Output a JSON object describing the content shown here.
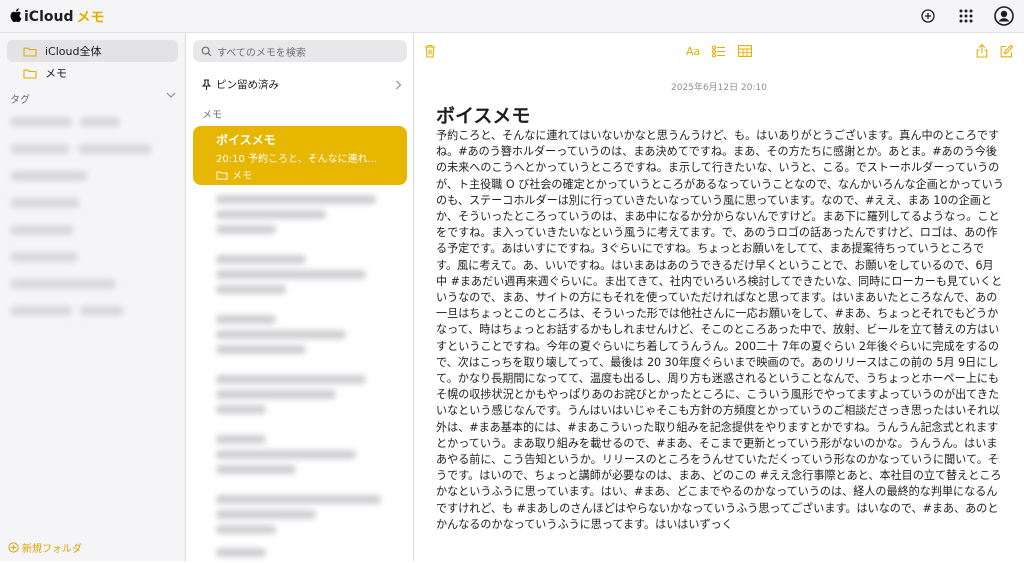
{
  "app": {
    "brand": "iCloud",
    "app_name": "メモ",
    "accent": "#e7b600"
  },
  "topbar": {
    "icons": [
      "add-circle-icon",
      "app-grid-icon",
      "account-icon"
    ]
  },
  "sidebar": {
    "folders": [
      {
        "label": "iCloud全体",
        "selected": true
      },
      {
        "label": "メモ",
        "selected": false
      }
    ],
    "tags_label": "タグ",
    "new_folder_label": "新規フォルダ"
  },
  "list": {
    "search_placeholder": "すべてのメモを検索",
    "pinned_label": "ピン留め済み",
    "section_label": "メモ",
    "selected_note": {
      "title": "ボイスメモ",
      "preview": "20:10 予約ころと、そんなに連れ...",
      "folder": "メモ"
    }
  },
  "editor": {
    "date": "2025年6月12日 20:10",
    "title": "ボイスメモ",
    "body": "予約ころと、そんなに連れてはいないかなと思うんうけど、も。はいありがとうございます。真ん中のところですね。#あのう簪ホルダーっていうのは、まあ決めてですね。まあ、その方たちに感謝とか。あとま。#あのう今後の未来へのこうへとかっていうところですね。ま示して行きたいな、いうと、こる。でストーホルダーっていうのが、ト主役職 O び社会の確定とかっていうところがあるなっていうことなので、なんかいろんな企画とかっていうのも、ステーコホルダーは別に行っていきたいなっていう風に思っています。なので、#ええ、まあ 10の企画とか、そういったところっていうのは、まあ中になるか分からないんですけど。まあ下に羅列してるようなっ。ことをですね。ま入っていきたいなという風うに考えてます。で、あのうロゴの話あったんですけど、ロゴは、あの作る予定です。あはいすにですね。3ぐらいにですね。ちょっとお願いをしてて、まあ提案待ちっていうところです。風に考えて。あ、いいですね。はいまあはあのうできるだけ早くということで、お願いをしているので、6月中 #まあだい週再来週ぐらいに。ま出てきて、社内でいろいろ検討してできたいな、同時にローカーも見ていくというなので、まあ、サイトの方にもそれを使っていただければなと思ってます。はいまあいたところなんで、あの一旦はちょっとこのところは、そういった形では他社さんに一応お願いをして、#まあ、ちょっとそれでもどうかなって、時はちょっとお話するかもしれませんけど、そこのところあった中で、放射、ビールを立て替えの方はいすということですね。今年の夏ぐらいにち着してうんうん。200二十 7年の夏ぐらい 2年後ぐらいに完成をするので、次はこっちを取り壊してって、最後は 20 30年度ぐらいまで映画ので。あのリリースはこの前の 5月 9日にして。かなり長期間になってて、温度も出るし、周り方も迷惑されるということなんで、うちょっとホーペー上にもそ幌の収捗状況とかもやっぱりあのお詫びとかったところに、こういう風形でやってますよっていうのが出てきたいなという感じなんです。うんはいはいじゃそこも方針の方頻度とかっていうのご相談ださっき思ったはいそれ以外は、#まあ基本的には、#まあこういった取り組みを記念提供をやりますとかですね。うんうん記念式とれますとかっていう。まあ取り組みを載せるので、#まあ、そこまで更新とっていう形がないのかな。うんうん。はいまあやる前に、こう告知というか。リリースのところをうんせていただくっていう形なのかなっていうに聞いて。そうです。はいので、ちょっと講師が必要なのは、まあ、どのこの #ええ念行事際とあと、本社目の立て替えところかなというふうに思っています。はい、#まあ、どこまでやるのかなっていうのは、経人の最終的な判単になるんですけれど、も #まあしのさんほどはやらないかなっていうふう思ってございます。はいなので、#まあ、あのとかんなるのかなっていうふうに思ってます。はいはいずっく"
  }
}
